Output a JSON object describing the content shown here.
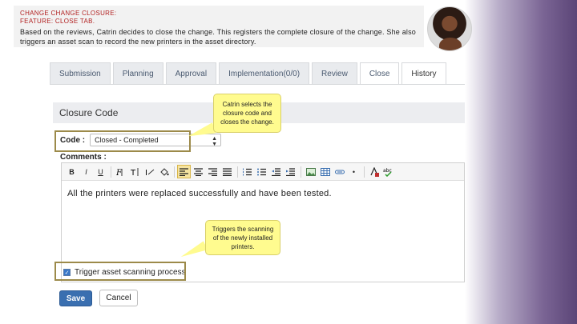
{
  "header": {
    "title_line1": "CHANGE CHANGE CLOSURE:",
    "title_line2": "FEATURE: CLOSE TAB.",
    "description": "Based on the reviews, Catrin decides to close the change. This registers the complete closure of the change. She also triggers an asset scan to record the new printers in the asset directory."
  },
  "tabs": [
    {
      "label": "Submission"
    },
    {
      "label": "Planning"
    },
    {
      "label": "Approval"
    },
    {
      "label": "Implementation(0/0)"
    },
    {
      "label": "Review"
    },
    {
      "label": "Close"
    },
    {
      "label": "History"
    }
  ],
  "section": {
    "title": "Closure Code"
  },
  "form": {
    "code_label": "Code :",
    "code_value": "Closed - Completed",
    "comments_label": "Comments :",
    "comment_text": "All the printers were replaced successfully and have been tested.",
    "trigger_label": "Trigger asset scanning process",
    "save_label": "Save",
    "cancel_label": "Cancel"
  },
  "toolbar": {
    "bold": "B",
    "italic": "I",
    "underline": "U"
  },
  "callouts": {
    "code_note": "Catrin selects the closure code and closes the change.",
    "trigger_note": "Triggers the scanning of the newly installed printers."
  },
  "colors": {
    "accent_blue": "#3a6fb0",
    "callout_yellow": "#fffb8f",
    "highlight_border": "#9c8a4a",
    "side_purple": "#5b4577"
  }
}
